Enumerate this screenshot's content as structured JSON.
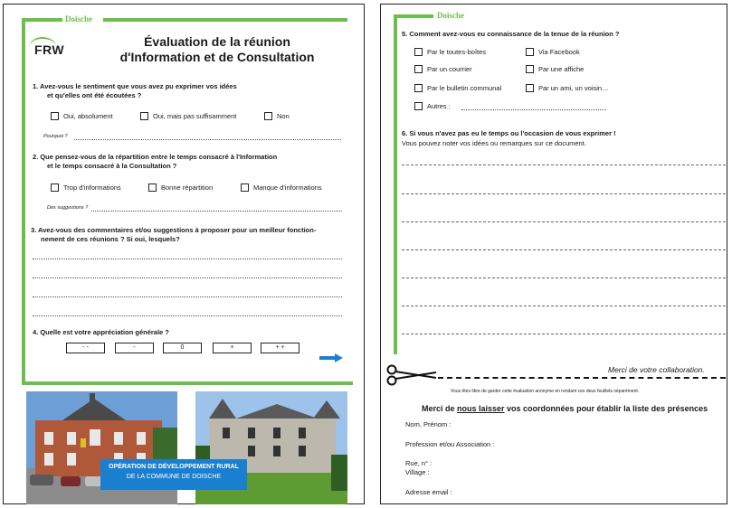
{
  "brand": {
    "tag": "Doische",
    "logo": "FRW",
    "green": "#6cbf4a",
    "blue": "#1b7fd0"
  },
  "page1": {
    "title_line1": "Évaluation de la réunion",
    "title_line2": "d'Information et de Consultation",
    "q1": {
      "text_line1": "1.    Avez-vous le sentiment que vous avez pu exprimer vos idées",
      "text_line2": "et qu'elles ont été écoutées ?",
      "options": [
        "Oui, absolument",
        "Oui, mais pas suffisamment",
        "Non"
      ],
      "followup": "Pourquoi ?"
    },
    "q2": {
      "text_line1": "2.    Que pensez-vous de la répartition entre le temps consacré à  l'Information",
      "text_line2": "et le temps consacré à la Consultation ?",
      "options": [
        "Trop d'informations",
        "Bonne répartition",
        "Manque  d'informations"
      ],
      "followup": "Des suggestions ?"
    },
    "q3": {
      "text_line1": "3. Avez-vous des commentaires et/ou suggestions à proposer pour un meilleur fonction-",
      "text_line2": "nement de ces réunions ? Si oui, lesquels?"
    },
    "q4": {
      "text": "4.    Quelle est votre appréciation générale ?",
      "scale": [
        "- -",
        "-",
        "0",
        "+",
        "+ +"
      ]
    },
    "banner_line1": "OPÉRATION DE DÉVELOPPEMENT RURAL",
    "banner_line2": "DE LA COMMUNE DE DOISCHE"
  },
  "page2": {
    "q5": {
      "text": "5.   Comment avez-vous eu connaissance de la tenue de la réunion ?",
      "options_left": [
        "Par le toutes-boîtes",
        "Par un courrier",
        "Par le bulletin communal",
        "Autres :"
      ],
      "options_right": [
        "Via Facebook",
        "Par une affiche",
        "Par un ami, un voisin…"
      ]
    },
    "q6": {
      "text": "6. Si vous n'avez pas eu le temps ou l'occasion de vous exprimer !",
      "subtext": "Vous pouvez noter vos idées ou remarques sur ce document."
    },
    "merci_collab": "Merci de votre collaboration.",
    "fine_print": "Vous êtes libre de garder cette évaluation anonyme en rendant ces deux feuillets séparément.",
    "merci_before": "Merci de ",
    "merci_underlined": "nous laisser",
    "merci_after": " vos coordonnées pour établir la liste des présences",
    "fields": [
      "Nom, Prénom :",
      "Profession et/ou Association :",
      "Rue, n° :",
      "Village :",
      "Adresse email :"
    ]
  }
}
